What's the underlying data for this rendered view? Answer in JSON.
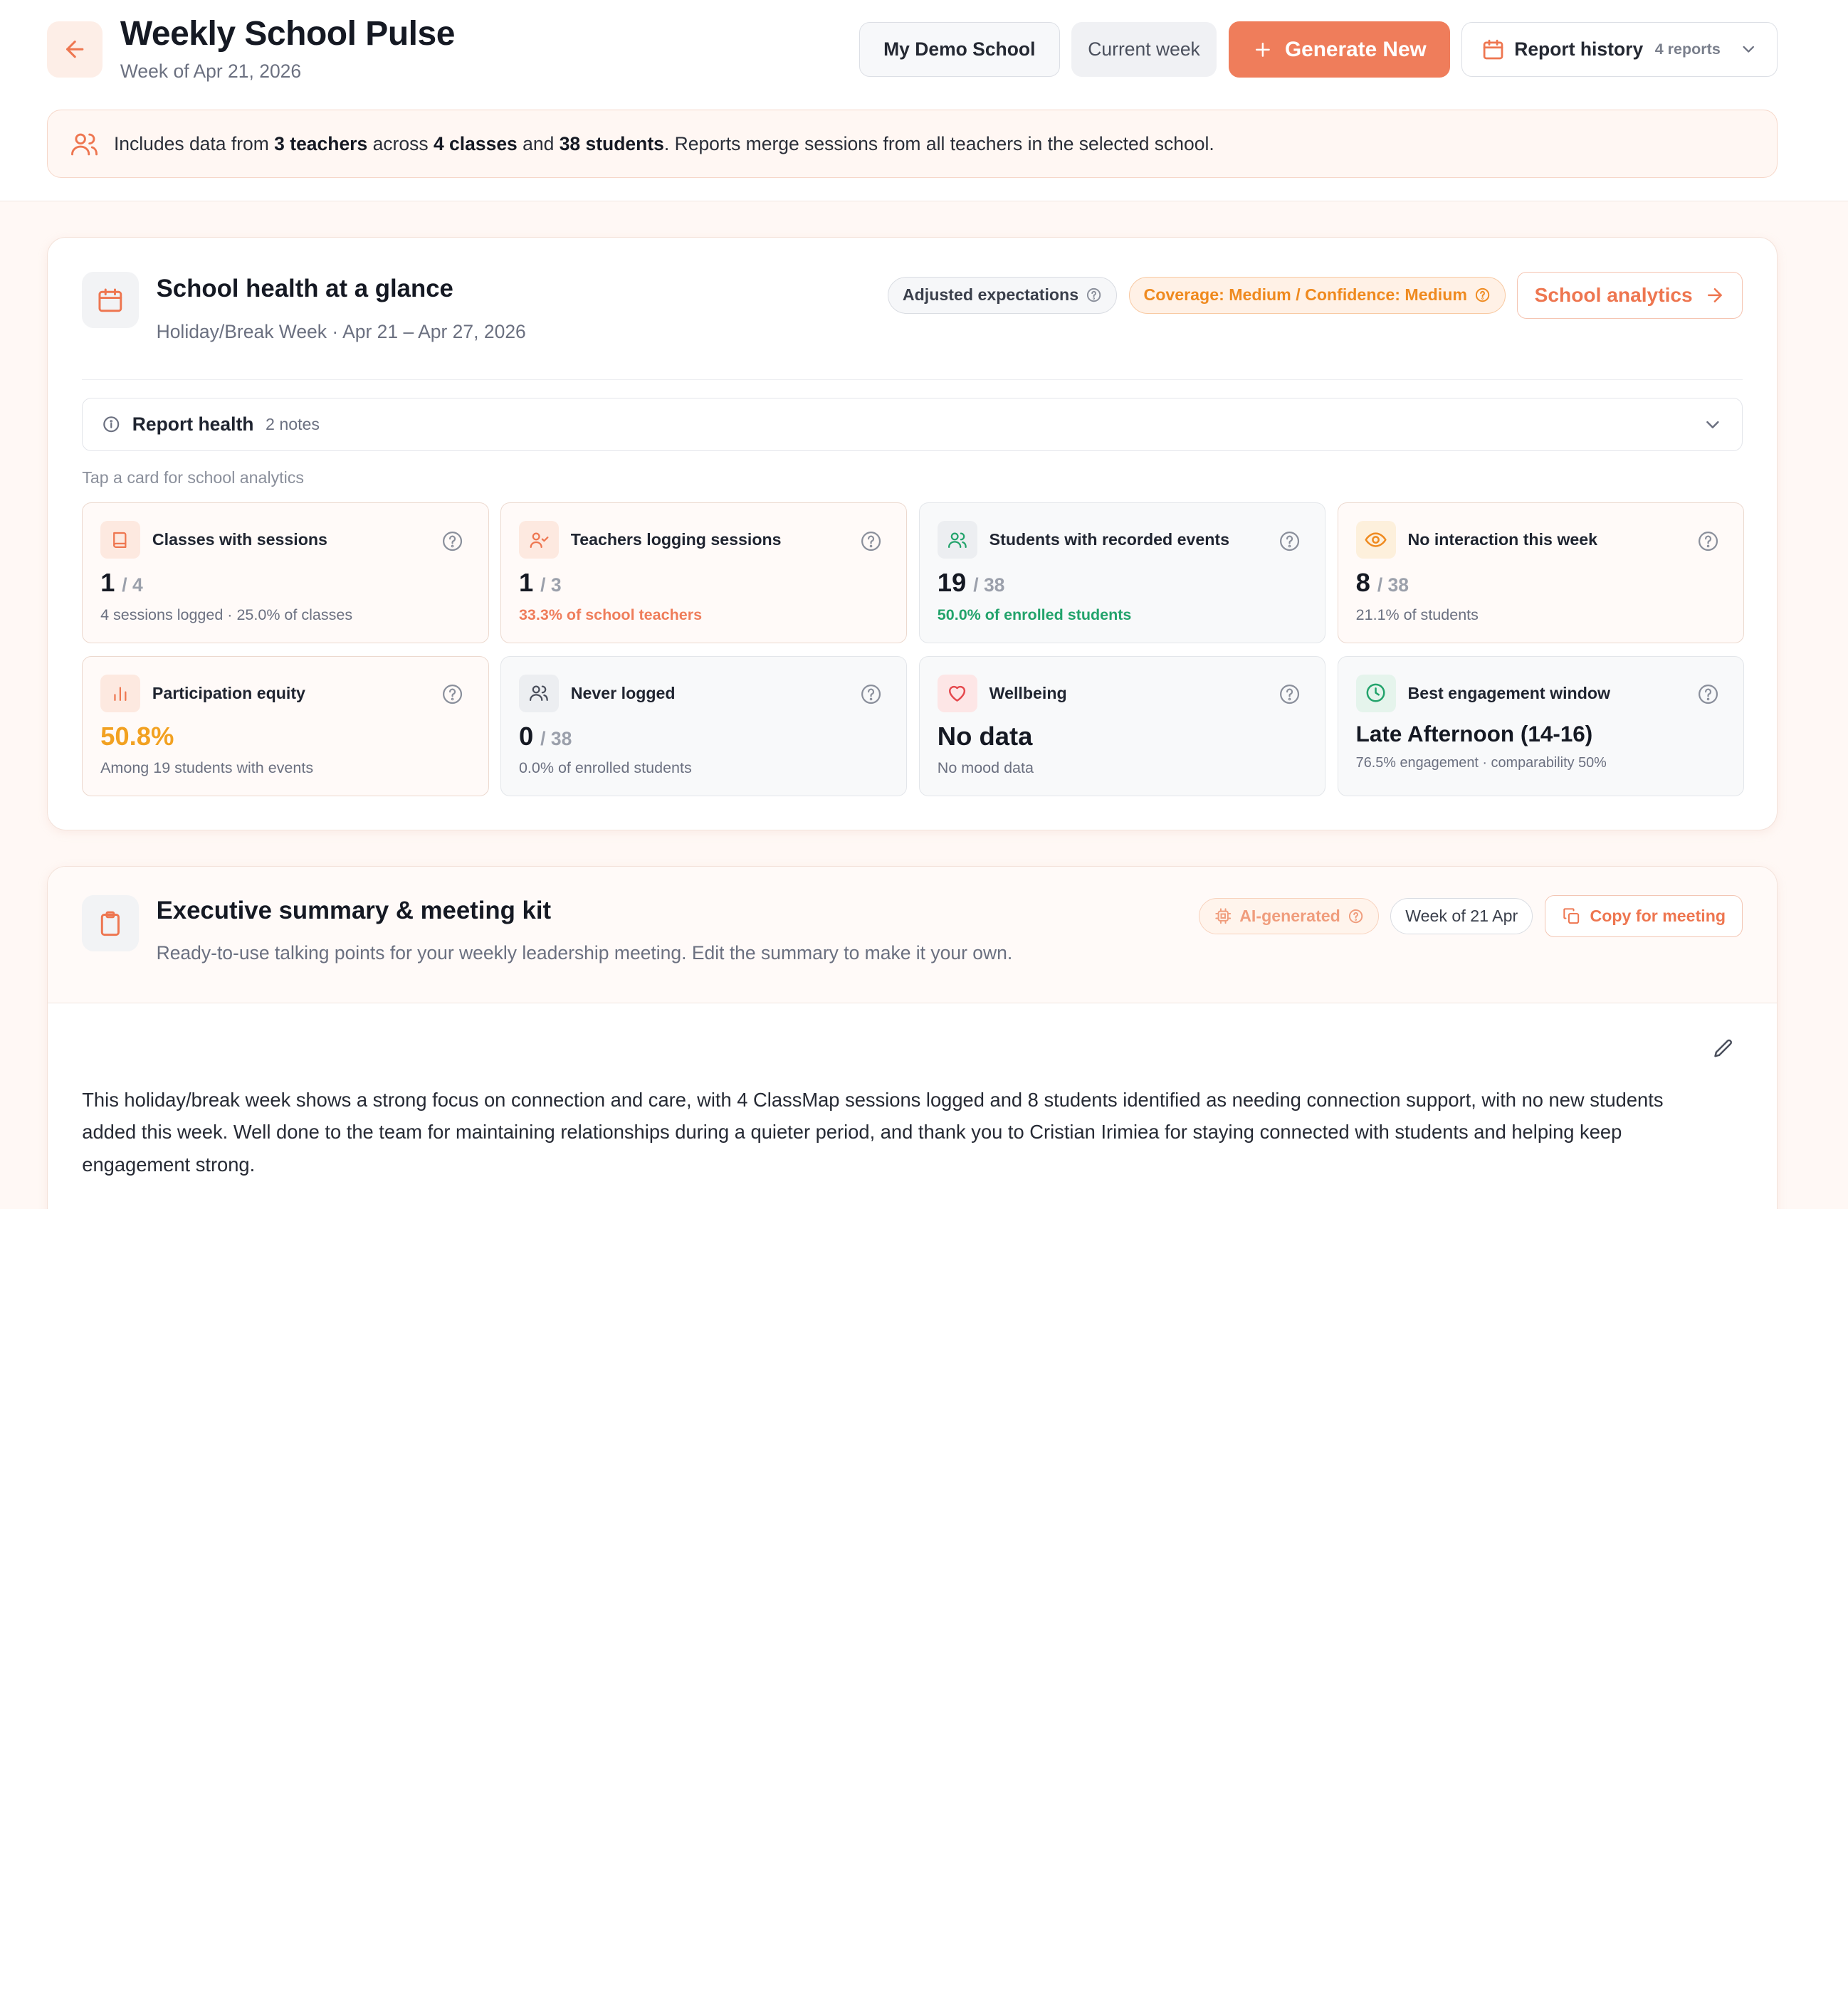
{
  "header": {
    "title": "Weekly School Pulse",
    "subtitle": "Week of Apr 21, 2026",
    "school_button": "My Demo School",
    "week_button": "Current week",
    "generate_button": "Generate New",
    "history_button": "Report history",
    "history_count": "4 reports"
  },
  "banner": {
    "prefix": "Includes data from ",
    "teachers": "3 teachers",
    "across": " across ",
    "classes": "4 classes",
    "and": " and ",
    "students": "38 students",
    "suffix": ". Reports merge sessions from all teachers in the selected school."
  },
  "health": {
    "title": "School health at a glance",
    "subtitle": "Holiday/Break Week · Apr 21 – Apr 27, 2026",
    "adjusted_pill": "Adjusted expectations",
    "coverage_pill": "Coverage: Medium / Confidence: Medium",
    "analytics_button": "School analytics",
    "report_health_label": "Report health",
    "report_health_notes": "2 notes",
    "tap_hint": "Tap a card for school analytics",
    "metrics": [
      {
        "title": "Classes with sessions",
        "value": "1",
        "denominator": "/ 4",
        "note": "4 sessions logged · 25.0% of classes"
      },
      {
        "title": "Teachers logging sessions",
        "value": "1",
        "denominator": "/ 3",
        "note": "33.3% of school teachers"
      },
      {
        "title": "Students with recorded events",
        "value": "19",
        "denominator": "/ 38",
        "note": "50.0% of enrolled students"
      },
      {
        "title": "No interaction this week",
        "value": "8",
        "denominator": "/ 38",
        "note": "21.1% of students"
      },
      {
        "title": "Participation equity",
        "value": "50.8%",
        "note": "Among 19 students with events"
      },
      {
        "title": "Never logged",
        "value": "0",
        "denominator": "/ 38",
        "note": "0.0% of enrolled students"
      },
      {
        "title": "Wellbeing",
        "value": "No data",
        "note": "No mood data"
      },
      {
        "title": "Best engagement window",
        "value": "Late Afternoon (14-16)",
        "note": "76.5% engagement · comparability 50%"
      }
    ]
  },
  "exec": {
    "title": "Executive summary & meeting kit",
    "subtitle": "Ready-to-use talking points for your weekly leadership meeting. Edit the summary to make it your own.",
    "ai_pill": "AI-generated",
    "week_pill": "Week of 21 Apr",
    "copy_button": "Copy for meeting",
    "summary": "This holiday/break week shows a strong focus on connection and care, with 4 ClassMap sessions logged and 8 students identified as needing connection support, with no new students added this week. Well done to the team for maintaining relationships during a quieter period, and thank you to Cristian Irimiea for staying connected with students and helping keep engagement strong."
  },
  "colors": {
    "accent": "#ef7d5b",
    "warning": "#ef8a1f",
    "success": "#22a36b",
    "equity": "#f2a121"
  }
}
